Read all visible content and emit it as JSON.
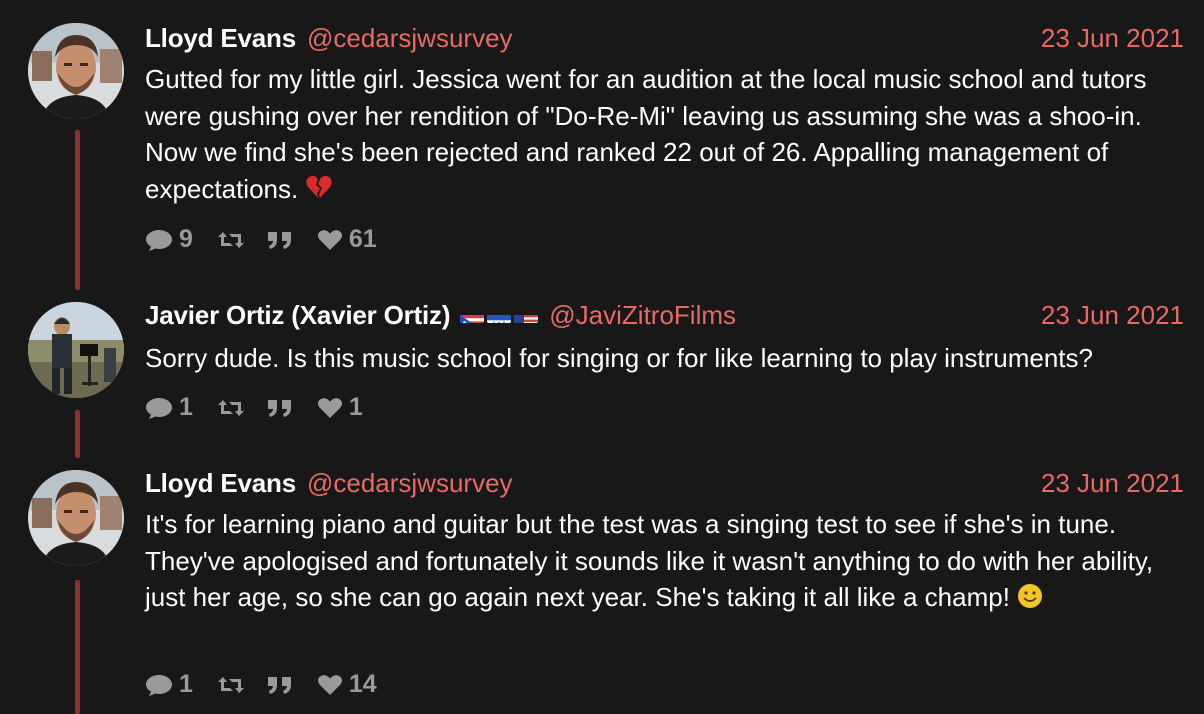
{
  "colors": {
    "background": "#181818",
    "accent": "#e86a62",
    "thread_line": "#8f2f2f",
    "muted": "#9a9a9a"
  },
  "tweets": [
    {
      "name": "Lloyd Evans",
      "handle": "@cedarsjwsurvey",
      "date": "23 Jun 2021",
      "text": "Gutted for my little girl. Jessica went for an audition at the local music school and tutors were gushing over her rendition of \"Do-Re-Mi\" leaving us assuming she was a shoo-in. Now we find she's been rejected and ranked 22 out of 26. Appalling management of expectations.",
      "emoji": "broken-heart",
      "replies": "9",
      "likes": "61"
    },
    {
      "name": "Javier Ortiz (Xavier Ortiz)",
      "flags": [
        "puerto-rico-flag",
        "honduras-flag",
        "usa-flag"
      ],
      "handle": "@JaviZitroFilms",
      "date": "23 Jun 2021",
      "text": "Sorry dude. Is this music school for singing or for like learning to play instruments?",
      "replies": "1",
      "likes": "1"
    },
    {
      "name": "Lloyd Evans",
      "handle": "@cedarsjwsurvey",
      "date": "23 Jun 2021",
      "text": "It's for learning piano and guitar but the test was a singing test to see if she's in tune. They've apologised and fortunately it sounds like it wasn't anything to do with her ability, just her age, so she can go again next year. She's taking it all like a champ!",
      "emoji": "slightly-smiling-face",
      "replies": "1",
      "likes": "14"
    }
  ]
}
